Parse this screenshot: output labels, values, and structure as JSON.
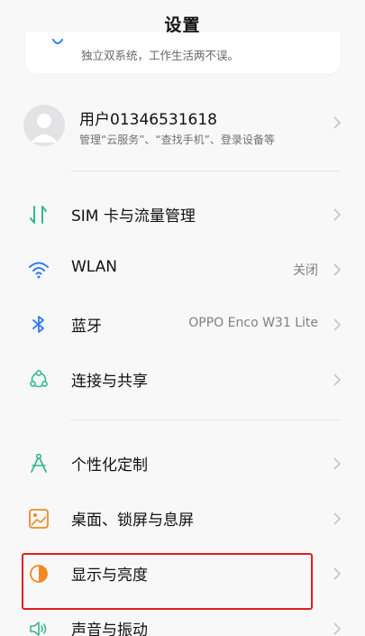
{
  "header": {
    "title": "设置"
  },
  "promo": {
    "text": "独立双系统，工作生活两不误。"
  },
  "account": {
    "name": "用户01346531618",
    "subtitle": "管理“云服务”、“查找手机”、登录设备等"
  },
  "groups": [
    {
      "items": [
        {
          "label": "SIM 卡与流量管理",
          "value": "",
          "icon": "sim-data-icon"
        },
        {
          "label": "WLAN",
          "value": "关闭",
          "icon": "wifi-icon"
        },
        {
          "label": "蓝牙",
          "value": "OPPO Enco W31 Lite",
          "icon": "bluetooth-icon"
        },
        {
          "label": "连接与共享",
          "value": "",
          "icon": "connection-share-icon"
        }
      ]
    },
    {
      "items": [
        {
          "label": "个性化定制",
          "value": "",
          "icon": "personalize-icon"
        },
        {
          "label": "桌面、锁屏与息屏",
          "value": "",
          "icon": "wallpaper-icon"
        },
        {
          "label": "显示与亮度",
          "value": "",
          "icon": "display-brightness-icon"
        },
        {
          "label": "声音与振动",
          "value": "",
          "icon": "sound-icon"
        }
      ]
    }
  ],
  "colors": {
    "accent_green": "#35b88a",
    "accent_blue": "#2f7bf5",
    "accent_orange": "#f08a24",
    "highlight_red": "#e41e1e"
  }
}
